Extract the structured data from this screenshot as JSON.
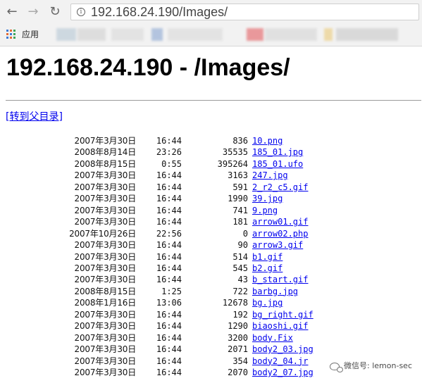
{
  "browser": {
    "back_icon": "←",
    "forward_icon": "→",
    "reload_icon": "↻",
    "info_icon": "i",
    "url": "192.168.24.190/Images/",
    "bookmark_label": "应用"
  },
  "page": {
    "heading": "192.168.24.190 - /Images/",
    "parent_link": "[转到父目录]"
  },
  "rows": [
    {
      "date": "2007年3月30日",
      "time": "16:44",
      "size": "836",
      "name": "10.png"
    },
    {
      "date": "2008年8月14日",
      "time": "23:26",
      "size": "35535",
      "name": "185_01.jpg"
    },
    {
      "date": "2008年8月15日",
      "time": "0:55",
      "size": "395264",
      "name": "185_01.ufo"
    },
    {
      "date": "2007年3月30日",
      "time": "16:44",
      "size": "3163",
      "name": "247.jpg"
    },
    {
      "date": "2007年3月30日",
      "time": "16:44",
      "size": "591",
      "name": "2_r2_c5.gif"
    },
    {
      "date": "2007年3月30日",
      "time": "16:44",
      "size": "1990",
      "name": "39.jpg"
    },
    {
      "date": "2007年3月30日",
      "time": "16:44",
      "size": "741",
      "name": "9.png"
    },
    {
      "date": "2007年3月30日",
      "time": "16:44",
      "size": "181",
      "name": "arrow01.gif"
    },
    {
      "date": "2007年10月26日",
      "time": "22:56",
      "size": "0",
      "name": "arrow02.php"
    },
    {
      "date": "2007年3月30日",
      "time": "16:44",
      "size": "90",
      "name": "arrow3.gif"
    },
    {
      "date": "2007年3月30日",
      "time": "16:44",
      "size": "514",
      "name": "b1.gif"
    },
    {
      "date": "2007年3月30日",
      "time": "16:44",
      "size": "545",
      "name": "b2.gif"
    },
    {
      "date": "2007年3月30日",
      "time": "16:44",
      "size": "43",
      "name": "b_start.gif"
    },
    {
      "date": "2008年8月15日",
      "time": "1:25",
      "size": "722",
      "name": "barbg.jpg"
    },
    {
      "date": "2008年1月16日",
      "time": "13:06",
      "size": "12678",
      "name": "bg.jpg"
    },
    {
      "date": "2007年3月30日",
      "time": "16:44",
      "size": "192",
      "name": "bg_right.gif"
    },
    {
      "date": "2007年3月30日",
      "time": "16:44",
      "size": "1290",
      "name": "biaoshi.gif"
    },
    {
      "date": "2007年3月30日",
      "time": "16:44",
      "size": "3200",
      "name": "body.Fix"
    },
    {
      "date": "2007年3月30日",
      "time": "16:44",
      "size": "2071",
      "name": "body2_03.jpg"
    },
    {
      "date": "2007年3月30日",
      "time": "16:44",
      "size": "354",
      "name": "body2_04.jr"
    },
    {
      "date": "2007年3月30日",
      "time": "16:44",
      "size": "2070",
      "name": "body2_07.jpg"
    }
  ],
  "watermark": {
    "text": "微信号: lemon-sec",
    "icon": "wechat-icon"
  },
  "colors": {
    "link": "#0000ee",
    "chrome": "#f2f2f2"
  }
}
